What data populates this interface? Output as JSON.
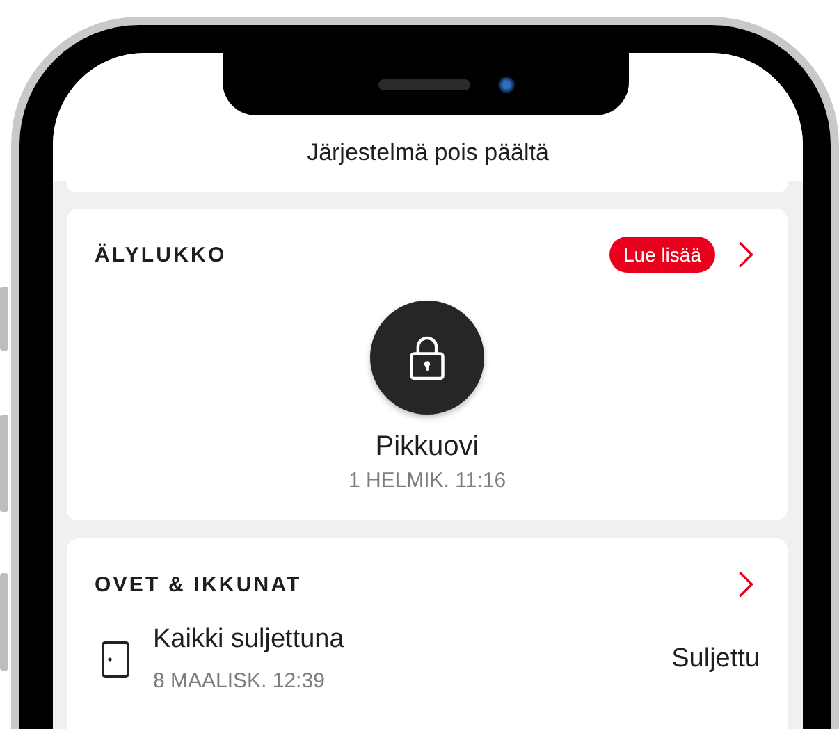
{
  "header": {
    "title": "Järjestelmä pois päältä"
  },
  "smart_lock": {
    "title": "ÄLYLUKKO",
    "badge": "Lue lisää",
    "locked": true,
    "lock_name": "Pikkuovi",
    "timestamp": "1 HELMIK. 11:16"
  },
  "doors_windows": {
    "title": "OVET & IKKUNAT",
    "summary": "Kaikki suljettuna",
    "timestamp": "8 MAALISK. 12:39",
    "status": "Suljettu"
  }
}
